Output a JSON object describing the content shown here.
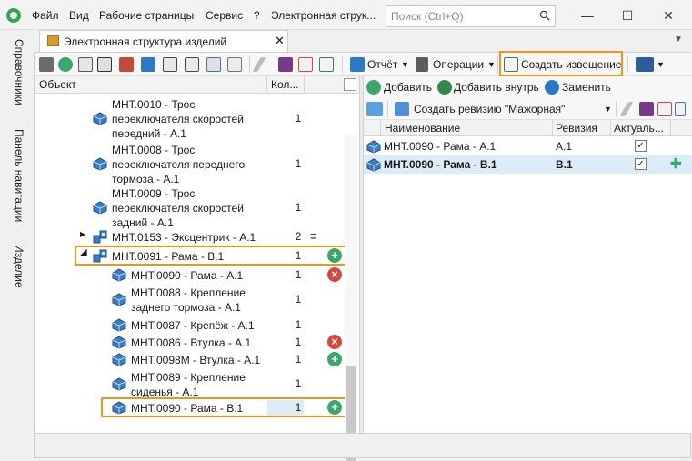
{
  "menu": [
    "Файл",
    "Вид",
    "Рабочие страницы",
    "Сервис",
    "?",
    "Электронная струк..."
  ],
  "search": {
    "placeholder": "Поиск (Ctrl+Q)"
  },
  "window": {
    "minimize": "—",
    "maximize": "☐",
    "close": "✕"
  },
  "left_rail": [
    "Справочники",
    "Панель навигации",
    "Изделие"
  ],
  "tab": {
    "label": "Электронная структура изделий",
    "close": "✕"
  },
  "toolbar": {
    "report": "Отчёт",
    "operations": "Операции",
    "create_notice": "Создать извещение",
    "add": "Добавить",
    "add_inside": "Добавить внутрь",
    "replace": "Заменить",
    "create_revision": "Создать ревизию \"Мажорная\""
  },
  "tree": {
    "col_object": "Объект",
    "col_qty": "Кол...",
    "rows": [
      {
        "lines": [
          "МНТ.0010 - Трос",
          "переключателя скоростей",
          "передний - А.1"
        ],
        "qty": "1"
      },
      {
        "lines": [
          "МНТ.0008 - Трос",
          "переключателя переднего",
          "тормоза - А.1"
        ],
        "qty": "1"
      },
      {
        "lines": [
          "МНТ.0009 - Трос",
          "переключателя скоростей",
          "задний - А.1"
        ],
        "qty": "1"
      },
      {
        "lines": [
          "МНТ.0153 - Эксцентрик - А.1"
        ],
        "qty": "2",
        "extra": "≡"
      },
      {
        "lines": [
          "МНТ.0091 - Рама - В.1"
        ],
        "qty": "1",
        "badge": "add"
      },
      {
        "lines": [
          "МНТ.0090 - Рама - А.1"
        ],
        "qty": "1",
        "badge": "del"
      },
      {
        "lines": [
          "МНТ.0088 - Крепление",
          "заднего тормоза - А.1"
        ],
        "qty": "1"
      },
      {
        "lines": [
          "МНТ.0087 - Крепёж - А.1"
        ],
        "qty": "1"
      },
      {
        "lines": [
          "МНТ.0086 - Втулка - А.1"
        ],
        "qty": "1",
        "badge": "del"
      },
      {
        "lines": [
          "МНТ.0098М - Втулка - А.1"
        ],
        "qty": "1",
        "badge": "add"
      },
      {
        "lines": [
          "МНТ.0089 - Крепление",
          "сиденья - А.1"
        ],
        "qty": "1"
      },
      {
        "lines": [
          "МНТ.0090 - Рама - В.1"
        ],
        "qty": "1",
        "badge": "add"
      }
    ]
  },
  "grid": {
    "col_name": "Наименование",
    "col_revision": "Ревизия",
    "col_actual": "Актуаль...",
    "rows": [
      {
        "name": "МНТ.0090 - Рама - А.1",
        "revision": "А.1",
        "actual": "✓"
      },
      {
        "name": "МНТ.0090 - Рама - В.1",
        "revision": "В.1",
        "actual": "✓",
        "plus": "✚"
      }
    ]
  },
  "colors": {
    "accent_orange": "#f0951b",
    "add_green": "#3aa76d",
    "delete_red": "#d9473b",
    "selected_row": "#dcebf8"
  }
}
